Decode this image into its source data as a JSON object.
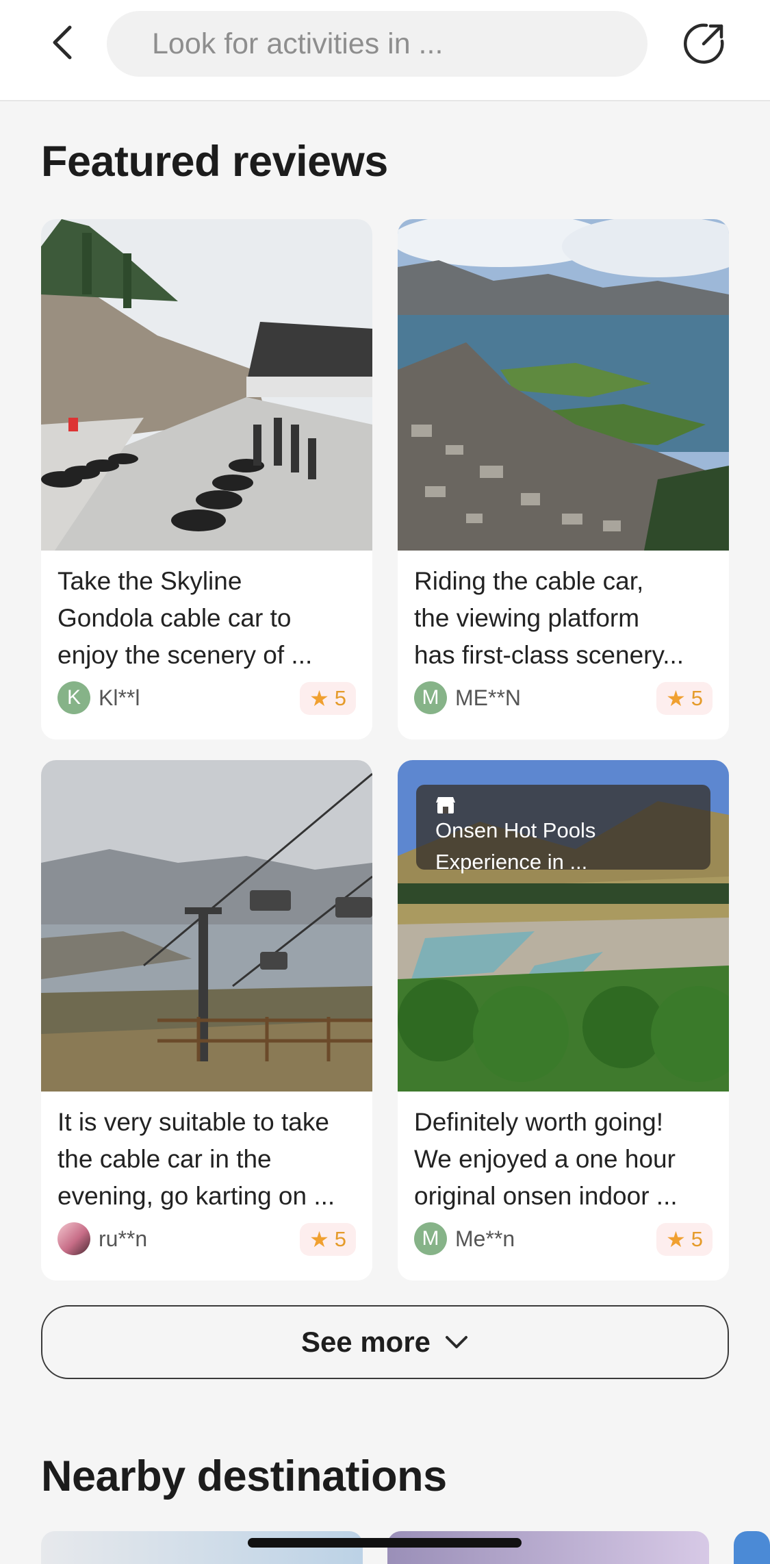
{
  "search": {
    "placeholder": "Look for activities in ..."
  },
  "featured": {
    "title": "Featured reviews",
    "reviews": [
      {
        "lines": [
          "Take the Skyline",
          "Gondola cable car to",
          "enjoy the scenery of ..."
        ],
        "author": "Kl**l",
        "avatar_letter": "K",
        "rating": "5"
      },
      {
        "lines": [
          "Riding the cable car,",
          "the viewing platform",
          "has first-class scenery..."
        ],
        "author": "ME**N",
        "avatar_letter": "M",
        "rating": "5"
      },
      {
        "lines": [
          "It is very suitable to take",
          "the cable car in the",
          "evening, go karting on ..."
        ],
        "author": "ru**n",
        "avatar_letter": "",
        "rating": "5"
      },
      {
        "lines": [
          "Definitely worth going!",
          "We enjoyed a one hour",
          "original onsen indoor ..."
        ],
        "author": "Me**n",
        "avatar_letter": "M",
        "rating": "5",
        "overlay_lines": [
          "Onsen Hot Pools",
          "Experience in ..."
        ]
      }
    ],
    "see_more": "See more"
  },
  "nearby": {
    "title": "Nearby destinations"
  },
  "icons": {
    "back": "chevron-left-icon",
    "share": "share-icon",
    "star": "star-icon",
    "chevron": "chevron-down-icon",
    "shop": "shop-icon"
  },
  "colors": {
    "rating_star": "#f0a030",
    "avatar_bg": "#86b388",
    "rating_bg": "#fdeeee"
  }
}
